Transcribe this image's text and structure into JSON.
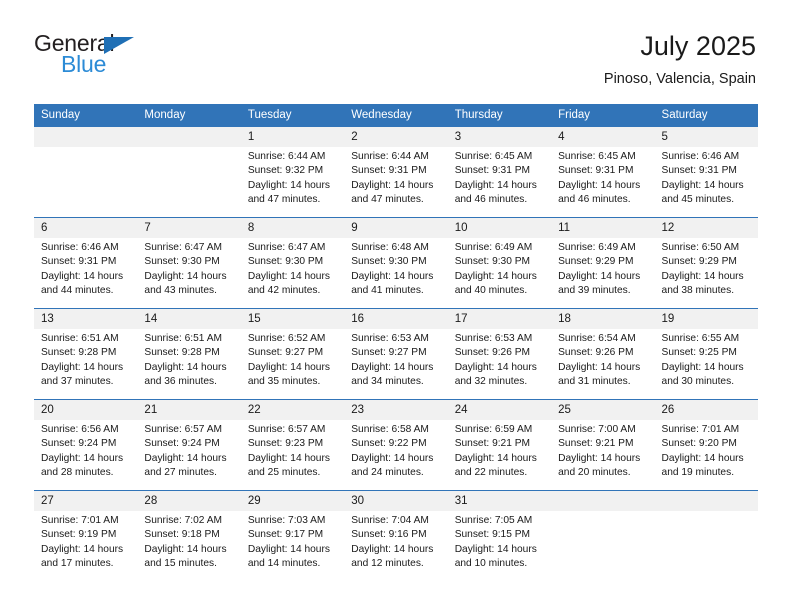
{
  "brand": {
    "name_dark": "General",
    "name_blue": "Blue",
    "triangle_icon": "logo-triangle"
  },
  "header": {
    "title": "July 2025",
    "location": "Pinoso, Valencia, Spain",
    "accent_color": "#3174b8",
    "brand_blue": "#2c8bd6",
    "daynum_band_color": "#f1f1f1"
  },
  "weekdays": [
    "Sunday",
    "Monday",
    "Tuesday",
    "Wednesday",
    "Thursday",
    "Friday",
    "Saturday"
  ],
  "weeks": [
    [
      {
        "day": "",
        "sunrise": "",
        "sunset": "",
        "daylight1": "",
        "daylight2": ""
      },
      {
        "day": "",
        "sunrise": "",
        "sunset": "",
        "daylight1": "",
        "daylight2": ""
      },
      {
        "day": "1",
        "sunrise": "Sunrise: 6:44 AM",
        "sunset": "Sunset: 9:32 PM",
        "daylight1": "Daylight: 14 hours",
        "daylight2": "and 47 minutes."
      },
      {
        "day": "2",
        "sunrise": "Sunrise: 6:44 AM",
        "sunset": "Sunset: 9:31 PM",
        "daylight1": "Daylight: 14 hours",
        "daylight2": "and 47 minutes."
      },
      {
        "day": "3",
        "sunrise": "Sunrise: 6:45 AM",
        "sunset": "Sunset: 9:31 PM",
        "daylight1": "Daylight: 14 hours",
        "daylight2": "and 46 minutes."
      },
      {
        "day": "4",
        "sunrise": "Sunrise: 6:45 AM",
        "sunset": "Sunset: 9:31 PM",
        "daylight1": "Daylight: 14 hours",
        "daylight2": "and 46 minutes."
      },
      {
        "day": "5",
        "sunrise": "Sunrise: 6:46 AM",
        "sunset": "Sunset: 9:31 PM",
        "daylight1": "Daylight: 14 hours",
        "daylight2": "and 45 minutes."
      }
    ],
    [
      {
        "day": "6",
        "sunrise": "Sunrise: 6:46 AM",
        "sunset": "Sunset: 9:31 PM",
        "daylight1": "Daylight: 14 hours",
        "daylight2": "and 44 minutes."
      },
      {
        "day": "7",
        "sunrise": "Sunrise: 6:47 AM",
        "sunset": "Sunset: 9:30 PM",
        "daylight1": "Daylight: 14 hours",
        "daylight2": "and 43 minutes."
      },
      {
        "day": "8",
        "sunrise": "Sunrise: 6:47 AM",
        "sunset": "Sunset: 9:30 PM",
        "daylight1": "Daylight: 14 hours",
        "daylight2": "and 42 minutes."
      },
      {
        "day": "9",
        "sunrise": "Sunrise: 6:48 AM",
        "sunset": "Sunset: 9:30 PM",
        "daylight1": "Daylight: 14 hours",
        "daylight2": "and 41 minutes."
      },
      {
        "day": "10",
        "sunrise": "Sunrise: 6:49 AM",
        "sunset": "Sunset: 9:30 PM",
        "daylight1": "Daylight: 14 hours",
        "daylight2": "and 40 minutes."
      },
      {
        "day": "11",
        "sunrise": "Sunrise: 6:49 AM",
        "sunset": "Sunset: 9:29 PM",
        "daylight1": "Daylight: 14 hours",
        "daylight2": "and 39 minutes."
      },
      {
        "day": "12",
        "sunrise": "Sunrise: 6:50 AM",
        "sunset": "Sunset: 9:29 PM",
        "daylight1": "Daylight: 14 hours",
        "daylight2": "and 38 minutes."
      }
    ],
    [
      {
        "day": "13",
        "sunrise": "Sunrise: 6:51 AM",
        "sunset": "Sunset: 9:28 PM",
        "daylight1": "Daylight: 14 hours",
        "daylight2": "and 37 minutes."
      },
      {
        "day": "14",
        "sunrise": "Sunrise: 6:51 AM",
        "sunset": "Sunset: 9:28 PM",
        "daylight1": "Daylight: 14 hours",
        "daylight2": "and 36 minutes."
      },
      {
        "day": "15",
        "sunrise": "Sunrise: 6:52 AM",
        "sunset": "Sunset: 9:27 PM",
        "daylight1": "Daylight: 14 hours",
        "daylight2": "and 35 minutes."
      },
      {
        "day": "16",
        "sunrise": "Sunrise: 6:53 AM",
        "sunset": "Sunset: 9:27 PM",
        "daylight1": "Daylight: 14 hours",
        "daylight2": "and 34 minutes."
      },
      {
        "day": "17",
        "sunrise": "Sunrise: 6:53 AM",
        "sunset": "Sunset: 9:26 PM",
        "daylight1": "Daylight: 14 hours",
        "daylight2": "and 32 minutes."
      },
      {
        "day": "18",
        "sunrise": "Sunrise: 6:54 AM",
        "sunset": "Sunset: 9:26 PM",
        "daylight1": "Daylight: 14 hours",
        "daylight2": "and 31 minutes."
      },
      {
        "day": "19",
        "sunrise": "Sunrise: 6:55 AM",
        "sunset": "Sunset: 9:25 PM",
        "daylight1": "Daylight: 14 hours",
        "daylight2": "and 30 minutes."
      }
    ],
    [
      {
        "day": "20",
        "sunrise": "Sunrise: 6:56 AM",
        "sunset": "Sunset: 9:24 PM",
        "daylight1": "Daylight: 14 hours",
        "daylight2": "and 28 minutes."
      },
      {
        "day": "21",
        "sunrise": "Sunrise: 6:57 AM",
        "sunset": "Sunset: 9:24 PM",
        "daylight1": "Daylight: 14 hours",
        "daylight2": "and 27 minutes."
      },
      {
        "day": "22",
        "sunrise": "Sunrise: 6:57 AM",
        "sunset": "Sunset: 9:23 PM",
        "daylight1": "Daylight: 14 hours",
        "daylight2": "and 25 minutes."
      },
      {
        "day": "23",
        "sunrise": "Sunrise: 6:58 AM",
        "sunset": "Sunset: 9:22 PM",
        "daylight1": "Daylight: 14 hours",
        "daylight2": "and 24 minutes."
      },
      {
        "day": "24",
        "sunrise": "Sunrise: 6:59 AM",
        "sunset": "Sunset: 9:21 PM",
        "daylight1": "Daylight: 14 hours",
        "daylight2": "and 22 minutes."
      },
      {
        "day": "25",
        "sunrise": "Sunrise: 7:00 AM",
        "sunset": "Sunset: 9:21 PM",
        "daylight1": "Daylight: 14 hours",
        "daylight2": "and 20 minutes."
      },
      {
        "day": "26",
        "sunrise": "Sunrise: 7:01 AM",
        "sunset": "Sunset: 9:20 PM",
        "daylight1": "Daylight: 14 hours",
        "daylight2": "and 19 minutes."
      }
    ],
    [
      {
        "day": "27",
        "sunrise": "Sunrise: 7:01 AM",
        "sunset": "Sunset: 9:19 PM",
        "daylight1": "Daylight: 14 hours",
        "daylight2": "and 17 minutes."
      },
      {
        "day": "28",
        "sunrise": "Sunrise: 7:02 AM",
        "sunset": "Sunset: 9:18 PM",
        "daylight1": "Daylight: 14 hours",
        "daylight2": "and 15 minutes."
      },
      {
        "day": "29",
        "sunrise": "Sunrise: 7:03 AM",
        "sunset": "Sunset: 9:17 PM",
        "daylight1": "Daylight: 14 hours",
        "daylight2": "and 14 minutes."
      },
      {
        "day": "30",
        "sunrise": "Sunrise: 7:04 AM",
        "sunset": "Sunset: 9:16 PM",
        "daylight1": "Daylight: 14 hours",
        "daylight2": "and 12 minutes."
      },
      {
        "day": "31",
        "sunrise": "Sunrise: 7:05 AM",
        "sunset": "Sunset: 9:15 PM",
        "daylight1": "Daylight: 14 hours",
        "daylight2": "and 10 minutes."
      },
      {
        "day": "",
        "sunrise": "",
        "sunset": "",
        "daylight1": "",
        "daylight2": ""
      },
      {
        "day": "",
        "sunrise": "",
        "sunset": "",
        "daylight1": "",
        "daylight2": ""
      }
    ]
  ]
}
